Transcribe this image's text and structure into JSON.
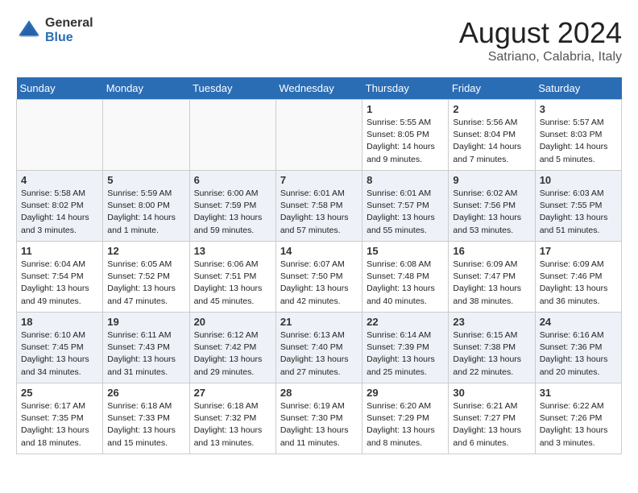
{
  "header": {
    "logo_general": "General",
    "logo_blue": "Blue",
    "month": "August 2024",
    "location": "Satriano, Calabria, Italy"
  },
  "weekdays": [
    "Sunday",
    "Monday",
    "Tuesday",
    "Wednesday",
    "Thursday",
    "Friday",
    "Saturday"
  ],
  "weeks": [
    [
      {
        "day": "",
        "info": ""
      },
      {
        "day": "",
        "info": ""
      },
      {
        "day": "",
        "info": ""
      },
      {
        "day": "",
        "info": ""
      },
      {
        "day": "1",
        "info": "Sunrise: 5:55 AM\nSunset: 8:05 PM\nDaylight: 14 hours\nand 9 minutes."
      },
      {
        "day": "2",
        "info": "Sunrise: 5:56 AM\nSunset: 8:04 PM\nDaylight: 14 hours\nand 7 minutes."
      },
      {
        "day": "3",
        "info": "Sunrise: 5:57 AM\nSunset: 8:03 PM\nDaylight: 14 hours\nand 5 minutes."
      }
    ],
    [
      {
        "day": "4",
        "info": "Sunrise: 5:58 AM\nSunset: 8:02 PM\nDaylight: 14 hours\nand 3 minutes."
      },
      {
        "day": "5",
        "info": "Sunrise: 5:59 AM\nSunset: 8:00 PM\nDaylight: 14 hours\nand 1 minute."
      },
      {
        "day": "6",
        "info": "Sunrise: 6:00 AM\nSunset: 7:59 PM\nDaylight: 13 hours\nand 59 minutes."
      },
      {
        "day": "7",
        "info": "Sunrise: 6:01 AM\nSunset: 7:58 PM\nDaylight: 13 hours\nand 57 minutes."
      },
      {
        "day": "8",
        "info": "Sunrise: 6:01 AM\nSunset: 7:57 PM\nDaylight: 13 hours\nand 55 minutes."
      },
      {
        "day": "9",
        "info": "Sunrise: 6:02 AM\nSunset: 7:56 PM\nDaylight: 13 hours\nand 53 minutes."
      },
      {
        "day": "10",
        "info": "Sunrise: 6:03 AM\nSunset: 7:55 PM\nDaylight: 13 hours\nand 51 minutes."
      }
    ],
    [
      {
        "day": "11",
        "info": "Sunrise: 6:04 AM\nSunset: 7:54 PM\nDaylight: 13 hours\nand 49 minutes."
      },
      {
        "day": "12",
        "info": "Sunrise: 6:05 AM\nSunset: 7:52 PM\nDaylight: 13 hours\nand 47 minutes."
      },
      {
        "day": "13",
        "info": "Sunrise: 6:06 AM\nSunset: 7:51 PM\nDaylight: 13 hours\nand 45 minutes."
      },
      {
        "day": "14",
        "info": "Sunrise: 6:07 AM\nSunset: 7:50 PM\nDaylight: 13 hours\nand 42 minutes."
      },
      {
        "day": "15",
        "info": "Sunrise: 6:08 AM\nSunset: 7:48 PM\nDaylight: 13 hours\nand 40 minutes."
      },
      {
        "day": "16",
        "info": "Sunrise: 6:09 AM\nSunset: 7:47 PM\nDaylight: 13 hours\nand 38 minutes."
      },
      {
        "day": "17",
        "info": "Sunrise: 6:09 AM\nSunset: 7:46 PM\nDaylight: 13 hours\nand 36 minutes."
      }
    ],
    [
      {
        "day": "18",
        "info": "Sunrise: 6:10 AM\nSunset: 7:45 PM\nDaylight: 13 hours\nand 34 minutes."
      },
      {
        "day": "19",
        "info": "Sunrise: 6:11 AM\nSunset: 7:43 PM\nDaylight: 13 hours\nand 31 minutes."
      },
      {
        "day": "20",
        "info": "Sunrise: 6:12 AM\nSunset: 7:42 PM\nDaylight: 13 hours\nand 29 minutes."
      },
      {
        "day": "21",
        "info": "Sunrise: 6:13 AM\nSunset: 7:40 PM\nDaylight: 13 hours\nand 27 minutes."
      },
      {
        "day": "22",
        "info": "Sunrise: 6:14 AM\nSunset: 7:39 PM\nDaylight: 13 hours\nand 25 minutes."
      },
      {
        "day": "23",
        "info": "Sunrise: 6:15 AM\nSunset: 7:38 PM\nDaylight: 13 hours\nand 22 minutes."
      },
      {
        "day": "24",
        "info": "Sunrise: 6:16 AM\nSunset: 7:36 PM\nDaylight: 13 hours\nand 20 minutes."
      }
    ],
    [
      {
        "day": "25",
        "info": "Sunrise: 6:17 AM\nSunset: 7:35 PM\nDaylight: 13 hours\nand 18 minutes."
      },
      {
        "day": "26",
        "info": "Sunrise: 6:18 AM\nSunset: 7:33 PM\nDaylight: 13 hours\nand 15 minutes."
      },
      {
        "day": "27",
        "info": "Sunrise: 6:18 AM\nSunset: 7:32 PM\nDaylight: 13 hours\nand 13 minutes."
      },
      {
        "day": "28",
        "info": "Sunrise: 6:19 AM\nSunset: 7:30 PM\nDaylight: 13 hours\nand 11 minutes."
      },
      {
        "day": "29",
        "info": "Sunrise: 6:20 AM\nSunset: 7:29 PM\nDaylight: 13 hours\nand 8 minutes."
      },
      {
        "day": "30",
        "info": "Sunrise: 6:21 AM\nSunset: 7:27 PM\nDaylight: 13 hours\nand 6 minutes."
      },
      {
        "day": "31",
        "info": "Sunrise: 6:22 AM\nSunset: 7:26 PM\nDaylight: 13 hours\nand 3 minutes."
      }
    ]
  ]
}
